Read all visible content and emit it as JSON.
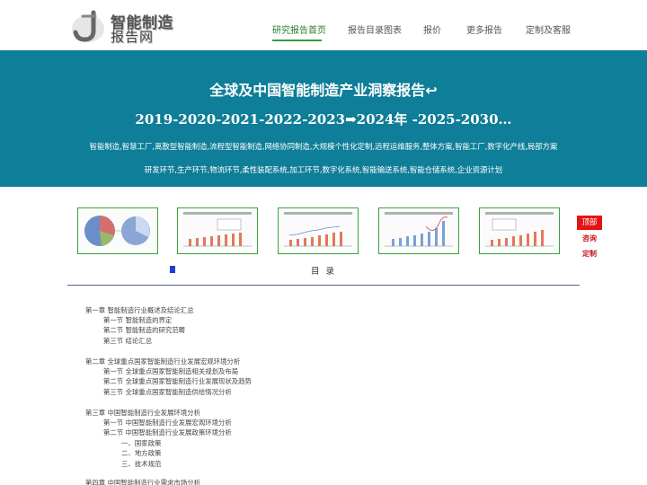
{
  "logo": {
    "line1": "智能制造",
    "line2": "报告网"
  },
  "nav": [
    {
      "label": "研究报告首页",
      "active": true
    },
    {
      "label": "报告目录图表",
      "active": false
    },
    {
      "label": "报价",
      "active": false
    },
    {
      "label": "更多报告",
      "active": false
    },
    {
      "label": "定制及客服",
      "active": false
    }
  ],
  "banner": {
    "title": "全球及中国智能制造产业洞察报告↩",
    "years": "2019-2020-2021-2022-2023➡2024年 -2025-2030…",
    "keywords_line1": "智能制造,智慧工厂,离散型智能制造,流程型智能制造,网络协同制造,大规模个性化定制,远程运维服务,整体方案,智能工厂,数字化产线,局部方案",
    "keywords_line2": "研发环节,生产环节,物流环节,柔性装配系统,加工环节,数字化系统,智能输送系统,智能仓储系统,企业资源计划"
  },
  "side": {
    "top": "顶部",
    "consult": "咨询",
    "custom": "定制"
  },
  "toc": {
    "title": "目 录",
    "items": [
      "第一章 智能制造行业概述及结论汇总",
      "第一节 智能制造的界定",
      "第二节 智能制造的研究范畴",
      "第三节 结论汇总",
      "第二章 全球重点国家智能制造行业发展宏观环境分析",
      "第一节 全球重点国家智能制造相关规划及布局",
      "第二节 全球重点国家智能制造行业发展现状及趋势",
      "第三节 全球重点国家智能制造供给情况分析",
      "第三章 中国智能制造行业发展环境分析",
      "第一节 中国智能制造行业发展宏观环境分析",
      "第二节 中国智能制造行业发展政策环境分析",
      "一、国家政策",
      "二、地方政策",
      "三、技术规范",
      "第四章 中国智能制造行业需求市场分析"
    ]
  },
  "colors": {
    "banner": "#0f7e98",
    "nav_active": "#2a7a2a",
    "thumb_border": "#3aa33a",
    "side_red": "#e41414"
  },
  "icons": {
    "logo": "logo-hook-icon",
    "toc_marker": "square-bullet-icon"
  }
}
